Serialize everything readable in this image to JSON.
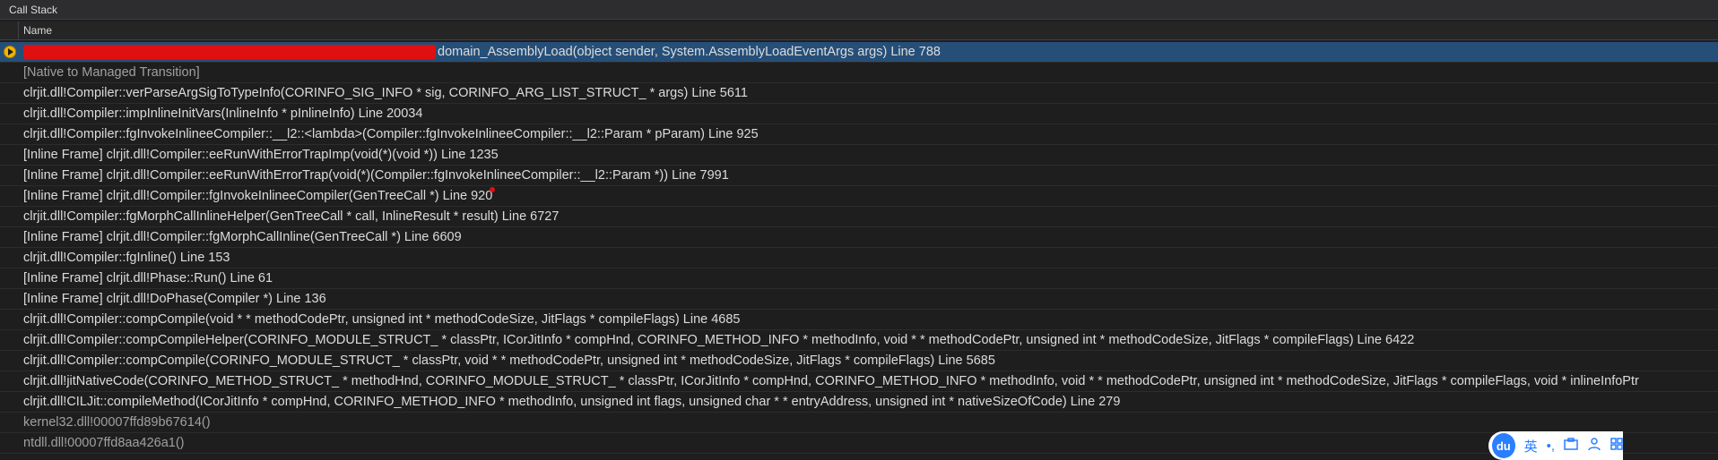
{
  "panel": {
    "title": "Call Stack",
    "column_header": "Name"
  },
  "rows": [
    {
      "text": "domain_AssemblyLoad(object sender, System.AssemblyLoadEventArgs args) Line 788",
      "current": true,
      "redacted_prefix": true
    },
    {
      "text": "[Native to Managed Transition]"
    },
    {
      "text": "clrjit.dll!Compiler::verParseArgSigToTypeInfo(CORINFO_SIG_INFO * sig, CORINFO_ARG_LIST_STRUCT_ * args) Line 5611"
    },
    {
      "text": "clrjit.dll!Compiler::impInlineInitVars(InlineInfo * pInlineInfo) Line 20034"
    },
    {
      "text": "clrjit.dll!Compiler::fgInvokeInlineeCompiler::__l2::<lambda>(Compiler::fgInvokeInlineeCompiler::__l2::Param * pParam) Line 925"
    },
    {
      "text": "[Inline Frame] clrjit.dll!Compiler::eeRunWithErrorTrapImp(void(*)(void *)) Line 1235"
    },
    {
      "text": "[Inline Frame] clrjit.dll!Compiler::eeRunWithErrorTrap(void(*)(Compiler::fgInvokeInlineeCompiler::__l2::Param *)) Line 7991"
    },
    {
      "text": "[Inline Frame] clrjit.dll!Compiler::fgInvokeInlineeCompiler(GenTreeCall *) Line 920"
    },
    {
      "text": "clrjit.dll!Compiler::fgMorphCallInlineHelper(GenTreeCall * call, InlineResult * result) Line 6727"
    },
    {
      "text": "[Inline Frame] clrjit.dll!Compiler::fgMorphCallInline(GenTreeCall *) Line 6609"
    },
    {
      "text": "clrjit.dll!Compiler::fgInline() Line 153"
    },
    {
      "text": "[Inline Frame] clrjit.dll!Phase::Run() Line 61"
    },
    {
      "text": "[Inline Frame] clrjit.dll!DoPhase(Compiler *) Line 136"
    },
    {
      "text": "clrjit.dll!Compiler::compCompile(void * * methodCodePtr, unsigned int * methodCodeSize, JitFlags * compileFlags) Line 4685"
    },
    {
      "text": "clrjit.dll!Compiler::compCompileHelper(CORINFO_MODULE_STRUCT_ * classPtr, ICorJitInfo * compHnd, CORINFO_METHOD_INFO * methodInfo, void * * methodCodePtr, unsigned int * methodCodeSize, JitFlags * compileFlags) Line 6422"
    },
    {
      "text": "clrjit.dll!Compiler::compCompile(CORINFO_MODULE_STRUCT_ * classPtr, void * * methodCodePtr, unsigned int * methodCodeSize, JitFlags * compileFlags) Line 5685"
    },
    {
      "text": "clrjit.dll!jitNativeCode(CORINFO_METHOD_STRUCT_ * methodHnd, CORINFO_MODULE_STRUCT_ * classPtr, ICorJitInfo * compHnd, CORINFO_METHOD_INFO * methodInfo, void * * methodCodePtr, unsigned int * methodCodeSize, JitFlags * compileFlags, void * inlineInfoPtr"
    },
    {
      "text": "clrjit.dll!CILJit::compileMethod(ICorJitInfo * compHnd, CORINFO_METHOD_INFO * methodInfo, unsigned int flags, unsigned char * * entryAddress, unsigned int * nativeSizeOfCode) Line 279"
    },
    {
      "text": "kernel32.dll!00007ffd89b67614()"
    },
    {
      "text": "ntdll.dll!00007ffd8aa426a1()"
    }
  ],
  "ime_toolbar": {
    "logo": "du",
    "lang": "英",
    "punct": "•,",
    "icon_names": [
      "briefcase-icon",
      "user-icon",
      "grid-icon"
    ]
  },
  "colors": {
    "background": "#1e1e1e",
    "current_row": "#264f78",
    "arrow": "#f4b400"
  }
}
